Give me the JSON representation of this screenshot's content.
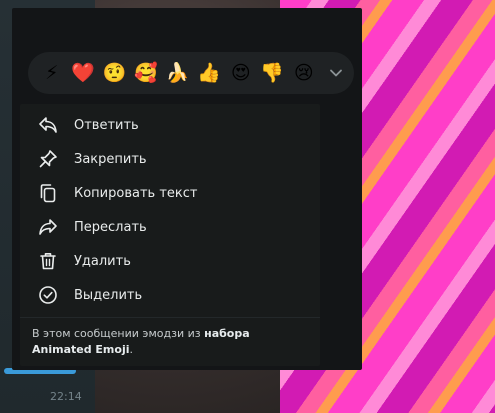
{
  "reactions": [
    {
      "emoji": "⚡",
      "name": "zap"
    },
    {
      "emoji": "❤️",
      "name": "heart"
    },
    {
      "emoji": "🤨",
      "name": "raised-eyebrow"
    },
    {
      "emoji": "🥰",
      "name": "smiling-hearts"
    },
    {
      "emoji": "🍌",
      "name": "banana"
    },
    {
      "emoji": "👍",
      "name": "thumbs-up"
    },
    {
      "emoji": "😍",
      "name": "heart-eyes"
    },
    {
      "emoji": "👎",
      "name": "thumbs-down"
    },
    {
      "emoji": "😢",
      "name": "crying"
    }
  ],
  "menu": {
    "items": [
      {
        "label": "Ответить",
        "icon": "reply-icon"
      },
      {
        "label": "Закрепить",
        "icon": "pin-icon"
      },
      {
        "label": "Копировать текст",
        "icon": "copy-icon"
      },
      {
        "label": "Переслать",
        "icon": "forward-icon"
      },
      {
        "label": "Удалить",
        "icon": "trash-icon"
      },
      {
        "label": "Выделить",
        "icon": "select-check-icon"
      }
    ],
    "footer": {
      "prefix": "В этом сообщении эмодзи из",
      "link": "набора Animated Emoji",
      "suffix": "."
    }
  },
  "chat": {
    "time": "22:14"
  },
  "colors": {
    "menu_bg": "#181b1b",
    "panel_bg": "#131517",
    "reaction_bar_bg": "#1f2224",
    "text": "#e9ecec",
    "accent": "#3a9ad9"
  }
}
